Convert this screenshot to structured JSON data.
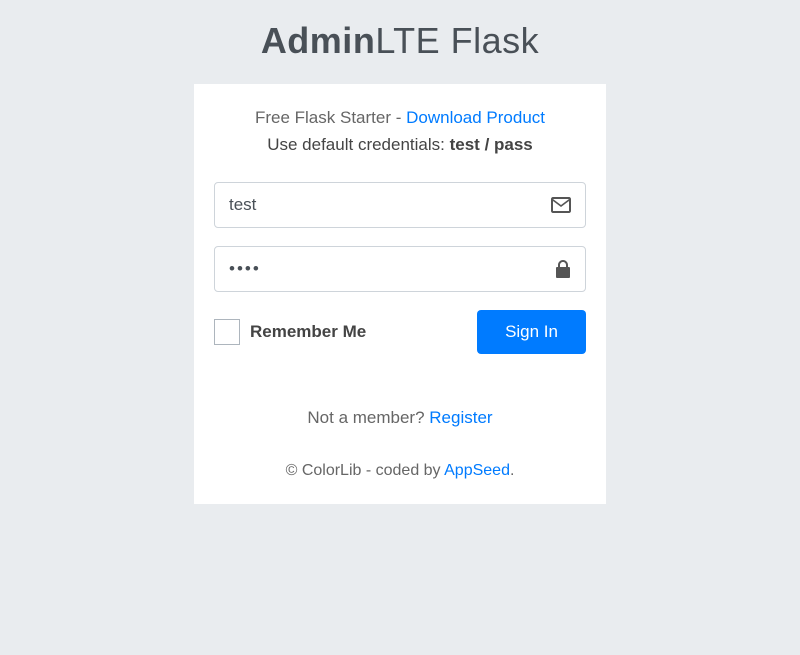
{
  "logo": {
    "bold": "Admin",
    "light": "LTE Flask"
  },
  "msg": {
    "starter_prefix": "Free Flask Starter - ",
    "download_link": "Download Product",
    "credentials_prefix": "Use default credentials: ",
    "credentials_value": "test / pass"
  },
  "form": {
    "username_value": "test",
    "password_value": "pass",
    "remember_label": "Remember Me",
    "signin_label": "Sign In"
  },
  "register": {
    "prefix": "Not a member? ",
    "link": "Register"
  },
  "footer": {
    "prefix": "© ColorLib - coded by ",
    "link": "AppSeed",
    "suffix": "."
  },
  "colors": {
    "accent": "#007bff",
    "background": "#e9ecef"
  }
}
